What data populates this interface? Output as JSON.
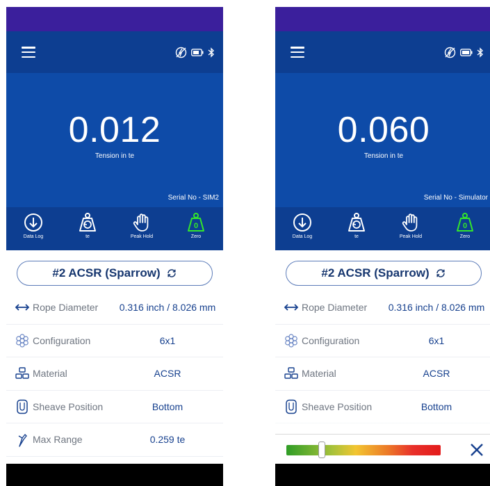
{
  "colors": {
    "status_bar": "#3b1f9c",
    "app_bar": "#0d3e91",
    "reading_bg": "#0e4ba8",
    "zero_icon": "#33e62b",
    "accent_text": "#16408e"
  },
  "screens": [
    {
      "reading": {
        "value": "0.012",
        "unit": "Tension in te",
        "serial": "Serial No - SIM2"
      },
      "toolbar": [
        {
          "icon": "download-circle-icon",
          "label": "Data Log"
        },
        {
          "icon": "unit-weight-icon",
          "label": "te"
        },
        {
          "icon": "hand-icon",
          "label": "Peak Hold"
        },
        {
          "icon": "zero-weight-icon",
          "label": "Zero"
        }
      ],
      "rope": {
        "name": "#2 ACSR (Sparrow)"
      },
      "rows": [
        {
          "icon": "diameter-icon",
          "label": "Rope Diameter",
          "value": "0.316 inch / 8.026 mm"
        },
        {
          "icon": "configuration-icon",
          "label": "Configuration",
          "value": "6x1"
        },
        {
          "icon": "material-icon",
          "label": "Material",
          "value": "ACSR"
        },
        {
          "icon": "sheave-icon",
          "label": "Sheave Position",
          "value": "Bottom"
        },
        {
          "icon": "max-range-icon",
          "label": "Max Range",
          "value": "0.259 te"
        }
      ]
    },
    {
      "reading": {
        "value": "0.060",
        "unit": "Tension in te",
        "serial": "Serial No - Simulator"
      },
      "toolbar": [
        {
          "icon": "download-circle-icon",
          "label": "Data Log"
        },
        {
          "icon": "unit-weight-icon",
          "label": "te"
        },
        {
          "icon": "hand-icon",
          "label": "Peak Hold"
        },
        {
          "icon": "zero-weight-icon",
          "label": "Zero"
        }
      ],
      "rope": {
        "name": "#2 ACSR (Sparrow)"
      },
      "rows": [
        {
          "icon": "diameter-icon",
          "label": "Rope Diameter",
          "value": "0.316 inch / 8.026 mm"
        },
        {
          "icon": "configuration-icon",
          "label": "Configuration",
          "value": "6x1"
        },
        {
          "icon": "material-icon",
          "label": "Material",
          "value": "ACSR"
        },
        {
          "icon": "sheave-icon",
          "label": "Sheave Position",
          "value": "Bottom"
        }
      ],
      "range_indicator": {
        "level": 0.23
      }
    }
  ]
}
